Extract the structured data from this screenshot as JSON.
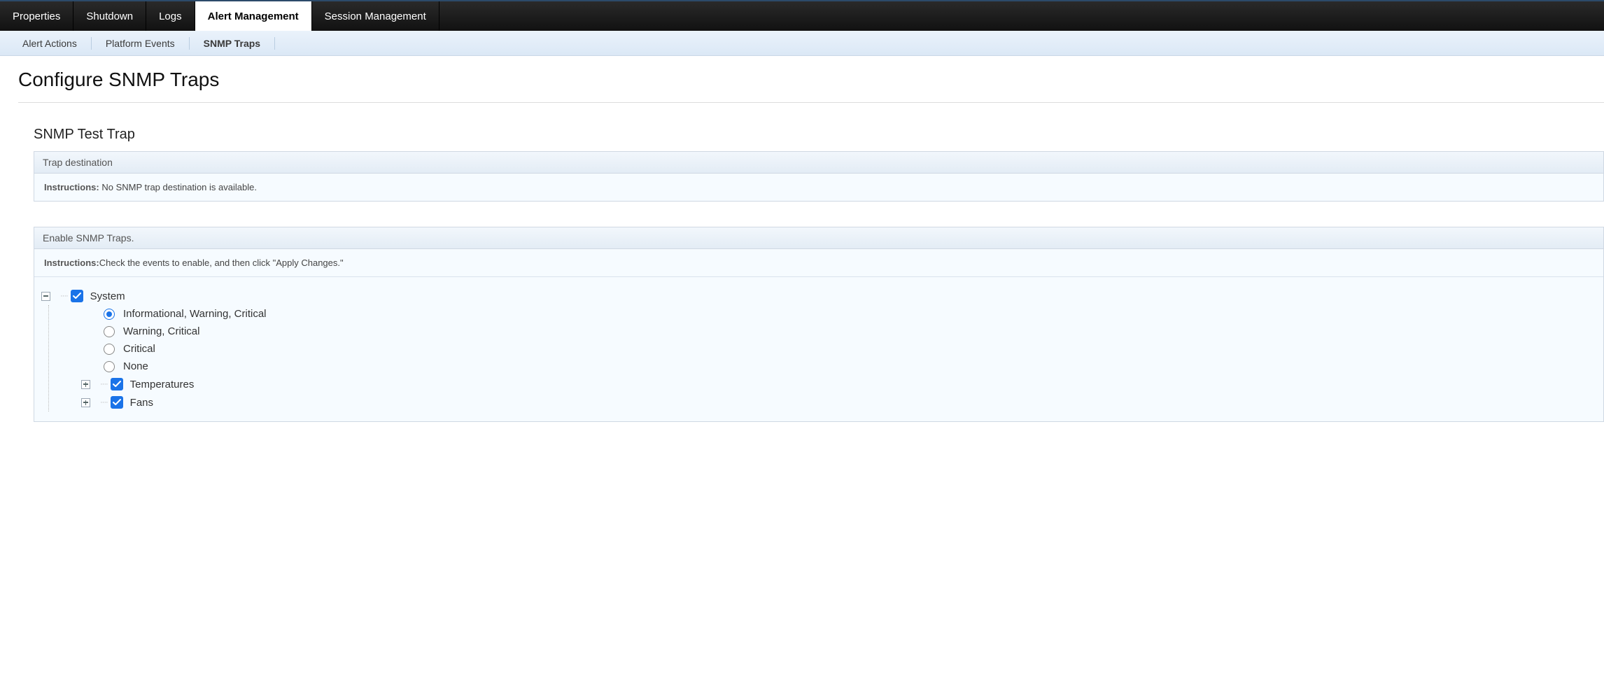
{
  "topTabs": {
    "items": [
      {
        "label": "Properties"
      },
      {
        "label": "Shutdown"
      },
      {
        "label": "Logs"
      },
      {
        "label": "Alert Management",
        "active": true
      },
      {
        "label": "Session Management"
      }
    ]
  },
  "subTabs": {
    "items": [
      {
        "label": "Alert Actions"
      },
      {
        "label": "Platform Events"
      },
      {
        "label": "SNMP Traps",
        "active": true
      }
    ]
  },
  "page": {
    "title": "Configure SNMP Traps"
  },
  "testTrap": {
    "sectionTitle": "SNMP Test Trap",
    "panelHead": "Trap destination",
    "instructionsLabel": "Instructions: ",
    "instructionsText": "No SNMP trap destination is available."
  },
  "enablePanel": {
    "panelHead": "Enable SNMP Traps.",
    "instructionsLabel": "Instructions:",
    "instructionsText": "Check the events to enable, and then click \"Apply Changes.\""
  },
  "tree": {
    "root": {
      "label": "System",
      "checked": true,
      "expanded": true,
      "radios": [
        {
          "label": "Informational, Warning, Critical",
          "selected": true
        },
        {
          "label": "Warning, Critical",
          "selected": false
        },
        {
          "label": "Critical",
          "selected": false
        },
        {
          "label": "None",
          "selected": false
        }
      ],
      "children": [
        {
          "label": "Temperatures",
          "checked": true,
          "expanded": false
        },
        {
          "label": "Fans",
          "checked": true,
          "expanded": false
        }
      ]
    }
  }
}
